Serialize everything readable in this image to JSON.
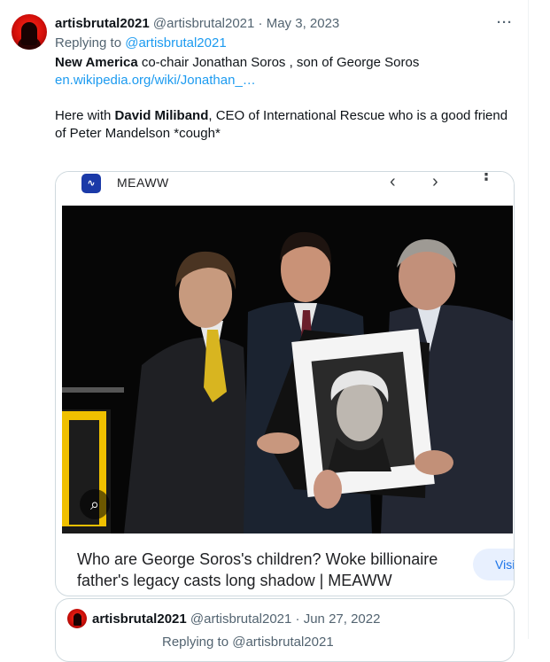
{
  "tweet": {
    "display_name": "artisbrutal2021",
    "handle": "@artisbrutal2021",
    "separator": "·",
    "date": "May 3, 2023",
    "more_label": "···",
    "replying_prefix": "Replying to ",
    "replying_to": "@artisbrutal2021",
    "line1_bold": "New America",
    "line1_rest": " co-chair Jonathan Soros , son of George Soros",
    "link_text": "en.wikipedia.org/wiki/Jonathan_…",
    "line3_prefix": "Here with ",
    "line3_bold": "David Miliband",
    "line3_rest": ", CEO of International Rescue who is a good friend of Peter Mandelson *cough*"
  },
  "card": {
    "site_name": "MEAWW",
    "site_logo_glyph": "∿",
    "nav_back": "‹",
    "nav_forward": "›",
    "nav_menu": "⋮",
    "lens_glyph": "⌕",
    "title": "Who are George Soros's children? Woke billionaire father's legacy casts long shadow | MEAWW",
    "visit_label": "Visit"
  },
  "quoted": {
    "display_name": "artisbrutal2021",
    "handle": "@artisbrutal2021",
    "separator": "·",
    "date": "Jun 27, 2022",
    "cut_text": "Replying to @artisbrutal2021"
  }
}
